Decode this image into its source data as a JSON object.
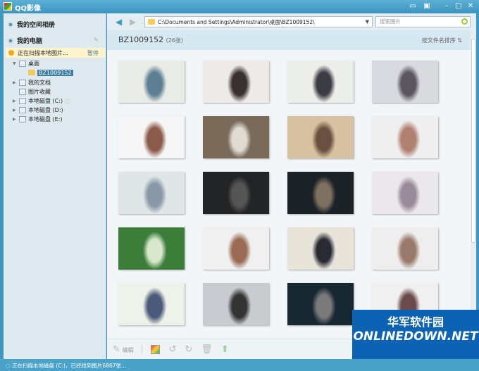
{
  "window": {
    "title": "QQ影像"
  },
  "sidebar": {
    "section_album": "我的空间相册",
    "section_computer": "我的电脑",
    "scan_text": "正在扫描本地图片...",
    "pause": "暂停",
    "tree": [
      {
        "label": "桌面",
        "icon": "desktop-icon",
        "expanded": true
      },
      {
        "label": "BZ1009152",
        "icon": "folder-icon",
        "selected": true
      },
      {
        "label": "我的文档",
        "icon": "documents-icon"
      },
      {
        "label": "图片收藏",
        "icon": "favorites-icon"
      },
      {
        "label": "本地磁盘 (C:)",
        "icon": "drive-icon",
        "loading": true
      },
      {
        "label": "本地磁盘 (D:)",
        "icon": "drive-icon"
      },
      {
        "label": "本地磁盘 (E:)",
        "icon": "drive-icon"
      }
    ]
  },
  "nav": {
    "path": "C:\\Documents and Settings\\Administrator\\桌面\\BZ1009152\\",
    "search_placeholder": "搜索图片"
  },
  "header": {
    "folder": "BZ1009152",
    "count": "(26张)",
    "sort": "按文件名排序"
  },
  "thumbnails": [
    [
      "#e9ece6",
      "#5c7f93"
    ],
    [
      "#eeeae8",
      "#3a3030"
    ],
    [
      "#eceee9",
      "#3b3b44"
    ],
    [
      "#d8dadf",
      "#5a5560"
    ],
    [
      "#f6f6f6",
      "#8a5a4a"
    ],
    [
      "#7a6a5a",
      "#e0dad3"
    ],
    [
      "#d6c2a0",
      "#6a5040"
    ],
    [
      "#efeff0",
      "#b08070"
    ],
    [
      "#e0e6e6",
      "#8898a6"
    ],
    [
      "#222426",
      "#555"
    ],
    [
      "#1b2228",
      "#807060"
    ],
    [
      "#ebe8ec",
      "#9a8a9a"
    ],
    [
      "#3c7d3a",
      "#d8e8cc"
    ],
    [
      "#f0f0f0",
      "#9a6a55"
    ],
    [
      "#e8e4da",
      "#2a2a34"
    ],
    [
      "#eeeeee",
      "#9a7a6a"
    ],
    [
      "#eef2ea",
      "#4a5a7a"
    ],
    [
      "#c8ccd0",
      "#333"
    ],
    [
      "#182833",
      "#7a7a7a"
    ],
    [
      "#f0f0f0",
      "#6a4a4a"
    ]
  ],
  "toolbar": {
    "edit": "编辑"
  },
  "status": "正在扫描本地磁盘 (C:)，已经找到图片6867张...",
  "watermark": {
    "cn": "华军软件园",
    "en": "ONLINEDOWN.NET"
  }
}
